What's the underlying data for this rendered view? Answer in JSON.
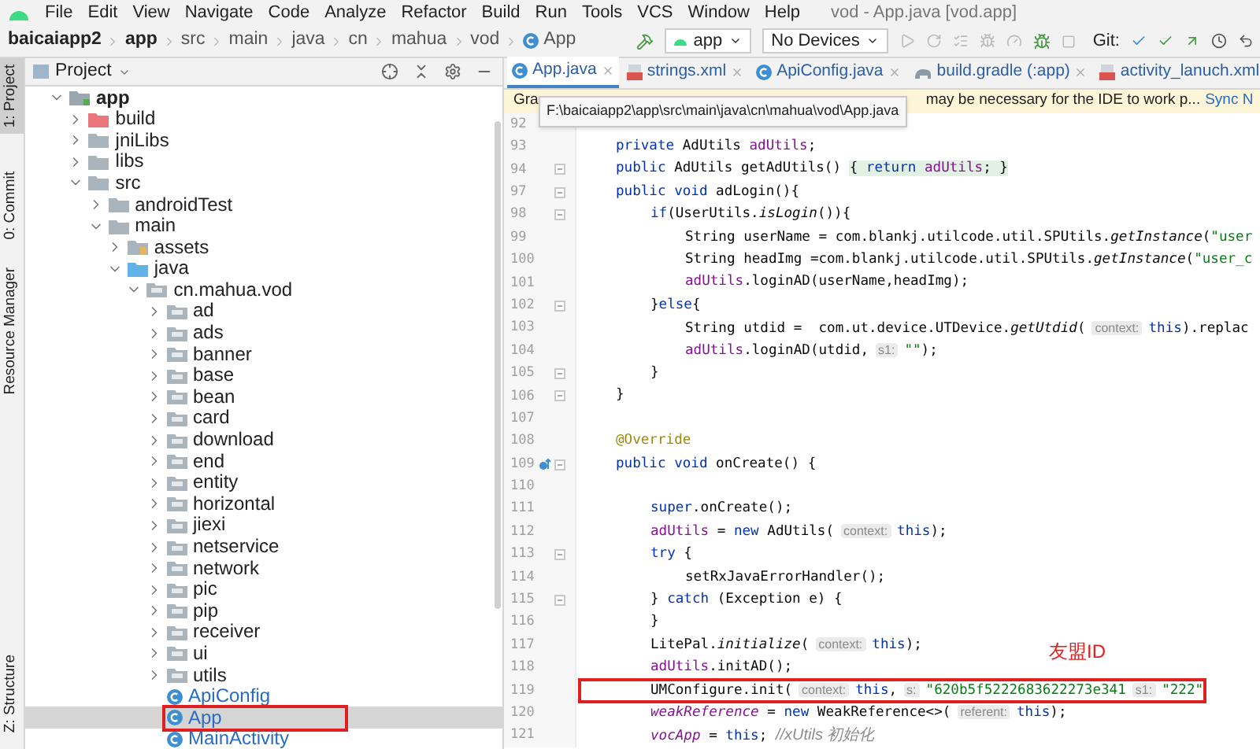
{
  "menu_bar": {
    "items": [
      "File",
      "Edit",
      "View",
      "Navigate",
      "Code",
      "Analyze",
      "Refactor",
      "Build",
      "Run",
      "Tools",
      "VCS",
      "Window",
      "Help"
    ],
    "window_title": "vod - App.java [vod.app]"
  },
  "breadcrumbs": [
    {
      "label": "baicaiapp2",
      "bold": true
    },
    {
      "label": "app",
      "bold": true
    },
    {
      "label": "src",
      "bold": false
    },
    {
      "label": "main",
      "bold": false
    },
    {
      "label": "java",
      "bold": false
    },
    {
      "label": "cn",
      "bold": false
    },
    {
      "label": "mahua",
      "bold": false
    },
    {
      "label": "vod",
      "bold": false
    },
    {
      "label": "App",
      "bold": false,
      "kind": "class"
    }
  ],
  "toolbar": {
    "config": "app",
    "device": "No Devices",
    "git_label": "Git:"
  },
  "tool_strip": [
    {
      "label": "1: Project",
      "selected": true
    },
    {
      "label": "0: Commit",
      "selected": false
    },
    {
      "label": "Resource Manager",
      "selected": false
    },
    {
      "label": "Z: Structure",
      "selected": false
    }
  ],
  "project_panel": {
    "title": "Project",
    "tree": [
      {
        "label": "app",
        "kind": "module",
        "expanded": true,
        "selected": false,
        "children": [
          {
            "label": "build",
            "kind": "excluded",
            "expanded": false,
            "selected": false
          },
          {
            "label": "jniLibs",
            "kind": "folder",
            "expanded": false,
            "selected": false
          },
          {
            "label": "libs",
            "kind": "folder",
            "expanded": false,
            "selected": false
          },
          {
            "label": "src",
            "kind": "folder",
            "expanded": true,
            "selected": false,
            "children": [
              {
                "label": "androidTest",
                "kind": "folder",
                "expanded": false,
                "selected": false
              },
              {
                "label": "main",
                "kind": "folder",
                "expanded": true,
                "selected": false,
                "children": [
                  {
                    "label": "assets",
                    "kind": "resources",
                    "expanded": false,
                    "selected": false
                  },
                  {
                    "label": "java",
                    "kind": "source",
                    "expanded": true,
                    "selected": false,
                    "children": [
                      {
                        "label": "cn.mahua.vod",
                        "kind": "package",
                        "expanded": true,
                        "selected": false,
                        "children": [
                          {
                            "label": "ad",
                            "kind": "package",
                            "expanded": false,
                            "selected": false
                          },
                          {
                            "label": "ads",
                            "kind": "package",
                            "expanded": false,
                            "selected": false
                          },
                          {
                            "label": "banner",
                            "kind": "package",
                            "expanded": false,
                            "selected": false
                          },
                          {
                            "label": "base",
                            "kind": "package",
                            "expanded": false,
                            "selected": false
                          },
                          {
                            "label": "bean",
                            "kind": "package",
                            "expanded": false,
                            "selected": false
                          },
                          {
                            "label": "card",
                            "kind": "package",
                            "expanded": false,
                            "selected": false
                          },
                          {
                            "label": "download",
                            "kind": "package",
                            "expanded": false,
                            "selected": false
                          },
                          {
                            "label": "end",
                            "kind": "package",
                            "expanded": false,
                            "selected": false
                          },
                          {
                            "label": "entity",
                            "kind": "package",
                            "expanded": false,
                            "selected": false
                          },
                          {
                            "label": "horizontal",
                            "kind": "package",
                            "expanded": false,
                            "selected": false
                          },
                          {
                            "label": "jiexi",
                            "kind": "package",
                            "expanded": false,
                            "selected": false
                          },
                          {
                            "label": "netservice",
                            "kind": "package",
                            "expanded": false,
                            "selected": false
                          },
                          {
                            "label": "network",
                            "kind": "package",
                            "expanded": false,
                            "selected": false
                          },
                          {
                            "label": "pic",
                            "kind": "package",
                            "expanded": false,
                            "selected": false
                          },
                          {
                            "label": "pip",
                            "kind": "package",
                            "expanded": false,
                            "selected": false
                          },
                          {
                            "label": "receiver",
                            "kind": "package",
                            "expanded": false,
                            "selected": false
                          },
                          {
                            "label": "ui",
                            "kind": "package",
                            "expanded": false,
                            "selected": false
                          },
                          {
                            "label": "utils",
                            "kind": "package",
                            "expanded": false,
                            "selected": false
                          },
                          {
                            "label": "ApiConfig",
                            "kind": "class",
                            "selected": false
                          },
                          {
                            "label": "App",
                            "kind": "class",
                            "selected": true
                          },
                          {
                            "label": "MainActivity",
                            "kind": "class",
                            "selected": false
                          }
                        ]
                      }
                    ]
                  }
                ]
              }
            ]
          }
        ]
      }
    ]
  },
  "editor": {
    "tabs": [
      {
        "label": "App.java",
        "kind": "class",
        "selected": true
      },
      {
        "label": "strings.xml",
        "kind": "xml",
        "selected": false
      },
      {
        "label": "ApiConfig.java",
        "kind": "class",
        "selected": false
      },
      {
        "label": "build.gradle (:app)",
        "kind": "gradle",
        "selected": false
      },
      {
        "label": "activity_lanuch.xml",
        "kind": "xml",
        "selected": false
      }
    ],
    "banner": {
      "start": "Gra",
      "end": "may be necessary for the IDE to work p...",
      "link": "Sync N"
    },
    "tooltip": "F:\\baicaiapp2\\app\\src\\main\\java\\cn\\mahua\\vod\\App.java",
    "callout": "友盟ID",
    "lines": [
      {
        "n": "92",
        "fold": false,
        "override": false
      },
      {
        "n": "93",
        "fold": false,
        "override": false,
        "boxed": false,
        "kind": "member",
        "segs": [
          {
            "kind": "kw",
            "text": "private"
          },
          {
            "kind": "p",
            "text": " AdUtils "
          },
          {
            "kind": "f",
            "text": "adUtils"
          },
          {
            "kind": "p",
            "text": ";"
          }
        ]
      },
      {
        "n": "94",
        "fold": true,
        "override": false,
        "boxed": false,
        "kind": "member",
        "segs": [
          {
            "kind": "kw",
            "text": "public"
          },
          {
            "kind": "p",
            "text": " AdUtils getAdUtils() "
          },
          {
            "kind": "fold-p",
            "text": "{ "
          },
          {
            "kind": "fold-kw",
            "text": "return "
          },
          {
            "kind": "fold-f",
            "text": "adUtils"
          },
          {
            "kind": "fold-p",
            "text": "; }"
          }
        ]
      },
      {
        "n": "97",
        "fold": true,
        "override": false,
        "boxed": false,
        "kind": "member",
        "segs": [
          {
            "kind": "kw",
            "text": "public void"
          },
          {
            "kind": "p",
            "text": " adLogin(){"
          }
        ]
      },
      {
        "n": "98",
        "fold": true,
        "override": false,
        "boxed": false,
        "kind": "method",
        "segs": [
          {
            "kind": "kw",
            "text": "if"
          },
          {
            "kind": "p",
            "text": "(UserUtils."
          },
          {
            "kind": "it",
            "text": "isLogin"
          },
          {
            "kind": "p",
            "text": "()){"
          }
        ]
      },
      {
        "n": "99",
        "fold": false,
        "override": false,
        "boxed": false,
        "kind": "block",
        "segs": [
          {
            "kind": "p",
            "text": "String userName = com.blankj.utilcode.util.SPUtils."
          },
          {
            "kind": "it",
            "text": "getInstance"
          },
          {
            "kind": "p",
            "text": "("
          },
          {
            "kind": "s",
            "text": "\"user"
          }
        ]
      },
      {
        "n": "100",
        "fold": false,
        "override": false,
        "boxed": false,
        "kind": "block",
        "segs": [
          {
            "kind": "p",
            "text": "String headImg =com.blankj.utilcode.util.SPUtils."
          },
          {
            "kind": "it",
            "text": "getInstance"
          },
          {
            "kind": "p",
            "text": "("
          },
          {
            "kind": "s",
            "text": "\"user_c"
          }
        ]
      },
      {
        "n": "101",
        "fold": false,
        "override": false,
        "boxed": false,
        "kind": "block",
        "segs": [
          {
            "kind": "f",
            "text": "adUtils"
          },
          {
            "kind": "p",
            "text": ".loginAD(userName,headImg);"
          }
        ]
      },
      {
        "n": "102",
        "fold": true,
        "override": false,
        "boxed": false,
        "kind": "method",
        "segs": [
          {
            "kind": "p",
            "text": "}"
          },
          {
            "kind": "kw",
            "text": "else"
          },
          {
            "kind": "p",
            "text": "{"
          }
        ]
      },
      {
        "n": "103",
        "fold": false,
        "override": false,
        "boxed": false,
        "kind": "block",
        "segs": [
          {
            "kind": "p",
            "text": "String utdid =  com.ut.device.UTDevice."
          },
          {
            "kind": "it",
            "text": "getUtdid"
          },
          {
            "kind": "p",
            "text": "("
          },
          {
            "kind": "h",
            "text": "context:"
          },
          {
            "kind": "kw",
            "text": "this"
          },
          {
            "kind": "p",
            "text": ").replac"
          }
        ]
      },
      {
        "n": "104",
        "fold": false,
        "override": false,
        "boxed": false,
        "kind": "block",
        "segs": [
          {
            "kind": "f",
            "text": "adUtils"
          },
          {
            "kind": "p",
            "text": ".loginAD(utdid,"
          },
          {
            "kind": "h",
            "text": "s1:"
          },
          {
            "kind": "s",
            "text": "\"\""
          },
          {
            "kind": "p",
            "text": ");"
          }
        ]
      },
      {
        "n": "105",
        "fold": true,
        "override": false,
        "boxed": false,
        "kind": "method",
        "segs": [
          {
            "kind": "p",
            "text": "}"
          }
        ]
      },
      {
        "n": "106",
        "fold": true,
        "override": false,
        "boxed": false,
        "kind": "member",
        "segs": [
          {
            "kind": "p",
            "text": "}"
          }
        ]
      },
      {
        "n": "107",
        "fold": false,
        "override": false
      },
      {
        "n": "108",
        "fold": false,
        "override": false,
        "boxed": false,
        "kind": "member",
        "segs": [
          {
            "kind": "ann",
            "text": "@Override"
          }
        ]
      },
      {
        "n": "109",
        "fold": true,
        "override": true,
        "boxed": false,
        "kind": "member",
        "segs": [
          {
            "kind": "kw",
            "text": "public void"
          },
          {
            "kind": "p",
            "text": " onCreate() {"
          }
        ]
      },
      {
        "n": "110",
        "fold": false,
        "override": false
      },
      {
        "n": "111",
        "fold": false,
        "override": false,
        "boxed": false,
        "kind": "method",
        "segs": [
          {
            "kind": "kw",
            "text": "super"
          },
          {
            "kind": "p",
            "text": ".onCreate();"
          }
        ]
      },
      {
        "n": "112",
        "fold": false,
        "override": false,
        "boxed": false,
        "kind": "method",
        "segs": [
          {
            "kind": "f",
            "text": "adUtils"
          },
          {
            "kind": "p",
            "text": " = "
          },
          {
            "kind": "kw",
            "text": "new"
          },
          {
            "kind": "p",
            "text": " AdUtils("
          },
          {
            "kind": "h",
            "text": "context:"
          },
          {
            "kind": "kw",
            "text": "this"
          },
          {
            "kind": "p",
            "text": ");"
          }
        ]
      },
      {
        "n": "113",
        "fold": true,
        "override": false,
        "boxed": false,
        "kind": "method",
        "segs": [
          {
            "kind": "kw",
            "text": "try"
          },
          {
            "kind": "p",
            "text": " {"
          }
        ]
      },
      {
        "n": "114",
        "fold": false,
        "override": false,
        "boxed": false,
        "kind": "block",
        "segs": [
          {
            "kind": "p",
            "text": "setRxJavaErrorHandler();"
          }
        ]
      },
      {
        "n": "115",
        "fold": true,
        "override": false,
        "boxed": false,
        "kind": "method",
        "segs": [
          {
            "kind": "p",
            "text": "} "
          },
          {
            "kind": "kw",
            "text": "catch"
          },
          {
            "kind": "p",
            "text": " (Exception e) {"
          }
        ]
      },
      {
        "n": "116",
        "fold": false,
        "override": false,
        "boxed": false,
        "kind": "method",
        "segs": [
          {
            "kind": "p",
            "text": "}"
          }
        ]
      },
      {
        "n": "117",
        "fold": false,
        "override": false,
        "boxed": false,
        "kind": "method",
        "segs": [
          {
            "kind": "p",
            "text": "LitePal."
          },
          {
            "kind": "it",
            "text": "initialize"
          },
          {
            "kind": "p",
            "text": "("
          },
          {
            "kind": "h",
            "text": "context:"
          },
          {
            "kind": "kw",
            "text": "this"
          },
          {
            "kind": "p",
            "text": ");"
          }
        ]
      },
      {
        "n": "118",
        "fold": false,
        "override": false,
        "boxed": false,
        "kind": "method",
        "segs": [
          {
            "kind": "f",
            "text": "adUtils"
          },
          {
            "kind": "p",
            "text": ".initAD();"
          }
        ]
      },
      {
        "n": "119",
        "fold": false,
        "override": false,
        "boxed": true,
        "kind": "method",
        "segs": [
          {
            "kind": "p",
            "text": "UMConfigure.init("
          },
          {
            "kind": "h",
            "text": "context:"
          },
          {
            "kind": "kw",
            "text": "this"
          },
          {
            "kind": "p",
            "text": ","
          },
          {
            "kind": "h",
            "text": "s:"
          },
          {
            "kind": "s",
            "text": "\"620b5f5222683622273e341"
          },
          {
            "kind": "h",
            "text": "s1:"
          },
          {
            "kind": "s",
            "text": "\"222\""
          }
        ]
      },
      {
        "n": "120",
        "fold": false,
        "override": false,
        "boxed": false,
        "kind": "method",
        "segs": [
          {
            "kind": "fit",
            "text": "weakReference"
          },
          {
            "kind": "p",
            "text": " = "
          },
          {
            "kind": "kw",
            "text": "new"
          },
          {
            "kind": "p",
            "text": " WeakReference<>("
          },
          {
            "kind": "h",
            "text": "referent:"
          },
          {
            "kind": "kw",
            "text": "this"
          },
          {
            "kind": "p",
            "text": ");"
          }
        ]
      },
      {
        "n": "121",
        "fold": false,
        "override": false,
        "boxed": false,
        "kind": "method",
        "segs": [
          {
            "kind": "fit",
            "text": "vocApp"
          },
          {
            "kind": "p",
            "text": " = "
          },
          {
            "kind": "kw",
            "text": "this"
          },
          {
            "kind": "p",
            "text": "; "
          },
          {
            "kind": "c",
            "text": "//xUtils 初始化"
          }
        ]
      }
    ]
  }
}
